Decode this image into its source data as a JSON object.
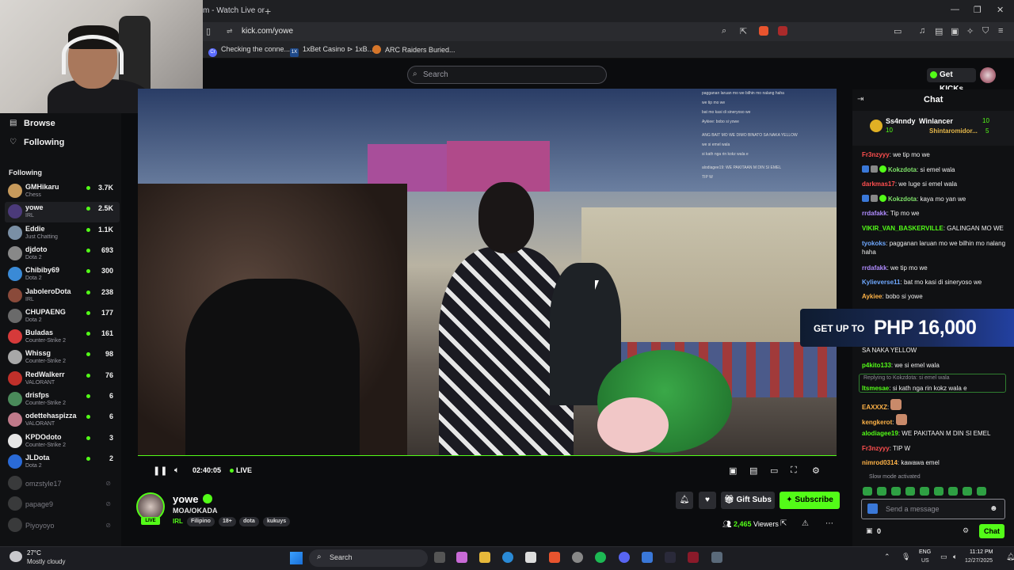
{
  "browser": {
    "tab_title": "m - Watch Live or",
    "new_tab": "+",
    "url": "kick.com/yowe",
    "bookmarks": [
      "Checking the conne...",
      "1xBet Casino ⊳ 1xB...",
      "ARC Raiders Buried..."
    ],
    "bookmark_icons": [
      "Cr",
      "1X",
      ""
    ]
  },
  "header": {
    "search_placeholder": "Search",
    "get_kicks": "Get KICKs"
  },
  "sidebar": {
    "browse": "Browse",
    "following_nav": "Following",
    "following_heading": "Following",
    "channels": [
      {
        "name": "GMHikaru",
        "game": "Chess",
        "viewers": "3.7K",
        "color": "#c79a5b"
      },
      {
        "name": "yowe",
        "game": "IRL",
        "viewers": "2.5K",
        "color": "#4b3a7a"
      },
      {
        "name": "Eddie",
        "game": "Just Chatting",
        "viewers": "1.1K",
        "color": "#7a8fa5"
      },
      {
        "name": "djdoto",
        "game": "Dota 2",
        "viewers": "693",
        "color": "#888"
      },
      {
        "name": "Chibiby69",
        "game": "Dota 2",
        "viewers": "300",
        "color": "#3a8ad6"
      },
      {
        "name": "JaboleroDota",
        "game": "IRL",
        "viewers": "238",
        "color": "#8a4a3a"
      },
      {
        "name": "CHUPAENG",
        "game": "Dota 2",
        "viewers": "177",
        "color": "#6a6a6a"
      },
      {
        "name": "Buladas",
        "game": "Counter-Strike 2",
        "viewers": "161",
        "color": "#d63a3a"
      },
      {
        "name": "Whissg",
        "game": "Counter-Strike 2",
        "viewers": "98",
        "color": "#a8a8a8"
      },
      {
        "name": "RedWalkerr",
        "game": "VALORANT",
        "viewers": "76",
        "color": "#c0302a"
      },
      {
        "name": "drisfps",
        "game": "Counter-Strike 2",
        "viewers": "6",
        "color": "#4a8a5a"
      },
      {
        "name": "odettehaspizza",
        "game": "VALORANT",
        "viewers": "6",
        "color": "#c07a8a"
      },
      {
        "name": "KPDOdoto",
        "game": "Counter-Strike 2",
        "viewers": "3",
        "color": "#e6e6e6"
      },
      {
        "name": "JLDota",
        "game": "Dota 2",
        "viewers": "2",
        "color": "#2a6ad6"
      }
    ],
    "offline": [
      "omzstyle17",
      "papage9",
      "Piyoyoyo"
    ]
  },
  "player": {
    "time": "02:40:05",
    "live": "LIVE",
    "progress": 1.0
  },
  "video_chat_overlay": [
    "pagganan laruan mo we bilhin mo nalang haha",
    "we tip mo we",
    "bat mo kasi di sineryoso we",
    "Aykiee: bobo si yowe",
    "ANG BAIT MO WE DIMO BINATO SA NAKA YELLOW",
    "we si emel wala",
    "si kath nga rin kokz wala e",
    "alodiagee19: WE PAKITAAN M DIN SI EMEL",
    "TIP W"
  ],
  "stream": {
    "live_badge": "LIVE",
    "name": "yowe",
    "title": "MOA/OKADA",
    "category": "IRL",
    "tags": [
      "Filipino",
      "18+",
      "dota",
      "kukuys"
    ],
    "gift_subs": "Gift Subs",
    "subscribe": "Subscribe",
    "viewers_count": "2,465",
    "viewers_label": "Viewers"
  },
  "chat": {
    "title": "Chat",
    "leaderboard": [
      {
        "name": "Ss4nndy",
        "count": "10"
      },
      {
        "name": "Winlancer",
        "count": "10"
      },
      {
        "name": "Shintaromidor...",
        "count": "5"
      }
    ],
    "messages": [
      {
        "user": "Fr3nzyyy",
        "text": "we tip mo we",
        "color": "#ff4f4f"
      },
      {
        "user": "Kokzdota",
        "text": "si emel wala",
        "color": "#7fe36a",
        "badges": 3
      },
      {
        "user": "darkmas17",
        "text": "we luge si emel wala",
        "color": "#ff4f4f"
      },
      {
        "user": "Kokzdota",
        "text": "kaya mo yan we",
        "color": "#7fe36a",
        "badges": 3
      },
      {
        "user": "rrdafakk",
        "text": "Tip mo we",
        "color": "#b08cff"
      },
      {
        "user": "VIKIR_VAN_BASKERVILLE",
        "text": "GALINGAN MO WE",
        "color": "#53fc18"
      },
      {
        "user": "tyokoks",
        "text": "pagganan laruan mo we bilhin mo nalang haha",
        "color": "#6fa8ff"
      },
      {
        "user": "rrdafakk",
        "text": "we tip mo we",
        "color": "#b08cff"
      },
      {
        "user": "Kylieverse11",
        "text": "bat mo kasi di sineryoso we",
        "color": "#6fa8ff"
      },
      {
        "user": "Aykiee",
        "text": "bobo si yowe",
        "color": "#ffb347"
      },
      {
        "user": "",
        "text": "SA NAKA YELLOW",
        "color": "#efefef"
      },
      {
        "user": "p4kito133",
        "text": "we si emel wala",
        "color": "#53fc18"
      },
      {
        "user": "Itsmesae",
        "text": "si kath nga rin kokz wala e",
        "color": "#53fc18"
      },
      {
        "user": "EAXXXZ",
        "text": "",
        "color": "#ffb347"
      },
      {
        "user": "kengkerot",
        "text": "",
        "color": "#ffb347"
      },
      {
        "user": "alodiagee19",
        "text": "WE PAKITAAN M DIN SI EMEL",
        "color": "#53fc18"
      },
      {
        "user": "Fr3nzyyy",
        "text": "TIP W",
        "color": "#ff4f4f"
      },
      {
        "user": "nimrod0314",
        "text": "kawawa emel",
        "color": "#ffb347"
      }
    ],
    "reply_hint": "Replying to Kokzdota: si emel wala",
    "promo_small": "GET UP TO",
    "promo_big": "PHP 16,000",
    "slow_mode": "Slow mode activated",
    "input_placeholder": "Send a message",
    "kicks_count": "0",
    "send_button": "Chat"
  },
  "taskbar": {
    "temp": "27°C",
    "weather": "Mostly cloudy",
    "search": "Search",
    "lang1": "ENG",
    "lang2": "US",
    "time": "11:12 PM",
    "date": "12/27/2025"
  },
  "colors": {
    "accent": "#53fc18",
    "background": "#0b0c0e",
    "panel": "#101113"
  }
}
